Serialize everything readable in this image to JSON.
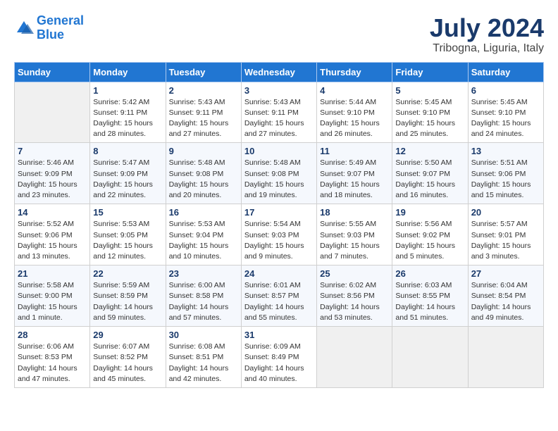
{
  "logo": {
    "line1": "General",
    "line2": "Blue"
  },
  "title": "July 2024",
  "subtitle": "Tribogna, Liguria, Italy",
  "weekdays": [
    "Sunday",
    "Monday",
    "Tuesday",
    "Wednesday",
    "Thursday",
    "Friday",
    "Saturday"
  ],
  "weeks": [
    [
      {
        "day": "",
        "info": ""
      },
      {
        "day": "1",
        "info": "Sunrise: 5:42 AM\nSunset: 9:11 PM\nDaylight: 15 hours\nand 28 minutes."
      },
      {
        "day": "2",
        "info": "Sunrise: 5:43 AM\nSunset: 9:11 PM\nDaylight: 15 hours\nand 27 minutes."
      },
      {
        "day": "3",
        "info": "Sunrise: 5:43 AM\nSunset: 9:11 PM\nDaylight: 15 hours\nand 27 minutes."
      },
      {
        "day": "4",
        "info": "Sunrise: 5:44 AM\nSunset: 9:10 PM\nDaylight: 15 hours\nand 26 minutes."
      },
      {
        "day": "5",
        "info": "Sunrise: 5:45 AM\nSunset: 9:10 PM\nDaylight: 15 hours\nand 25 minutes."
      },
      {
        "day": "6",
        "info": "Sunrise: 5:45 AM\nSunset: 9:10 PM\nDaylight: 15 hours\nand 24 minutes."
      }
    ],
    [
      {
        "day": "7",
        "info": "Sunrise: 5:46 AM\nSunset: 9:09 PM\nDaylight: 15 hours\nand 23 minutes."
      },
      {
        "day": "8",
        "info": "Sunrise: 5:47 AM\nSunset: 9:09 PM\nDaylight: 15 hours\nand 22 minutes."
      },
      {
        "day": "9",
        "info": "Sunrise: 5:48 AM\nSunset: 9:08 PM\nDaylight: 15 hours\nand 20 minutes."
      },
      {
        "day": "10",
        "info": "Sunrise: 5:48 AM\nSunset: 9:08 PM\nDaylight: 15 hours\nand 19 minutes."
      },
      {
        "day": "11",
        "info": "Sunrise: 5:49 AM\nSunset: 9:07 PM\nDaylight: 15 hours\nand 18 minutes."
      },
      {
        "day": "12",
        "info": "Sunrise: 5:50 AM\nSunset: 9:07 PM\nDaylight: 15 hours\nand 16 minutes."
      },
      {
        "day": "13",
        "info": "Sunrise: 5:51 AM\nSunset: 9:06 PM\nDaylight: 15 hours\nand 15 minutes."
      }
    ],
    [
      {
        "day": "14",
        "info": "Sunrise: 5:52 AM\nSunset: 9:06 PM\nDaylight: 15 hours\nand 13 minutes."
      },
      {
        "day": "15",
        "info": "Sunrise: 5:53 AM\nSunset: 9:05 PM\nDaylight: 15 hours\nand 12 minutes."
      },
      {
        "day": "16",
        "info": "Sunrise: 5:53 AM\nSunset: 9:04 PM\nDaylight: 15 hours\nand 10 minutes."
      },
      {
        "day": "17",
        "info": "Sunrise: 5:54 AM\nSunset: 9:03 PM\nDaylight: 15 hours\nand 9 minutes."
      },
      {
        "day": "18",
        "info": "Sunrise: 5:55 AM\nSunset: 9:03 PM\nDaylight: 15 hours\nand 7 minutes."
      },
      {
        "day": "19",
        "info": "Sunrise: 5:56 AM\nSunset: 9:02 PM\nDaylight: 15 hours\nand 5 minutes."
      },
      {
        "day": "20",
        "info": "Sunrise: 5:57 AM\nSunset: 9:01 PM\nDaylight: 15 hours\nand 3 minutes."
      }
    ],
    [
      {
        "day": "21",
        "info": "Sunrise: 5:58 AM\nSunset: 9:00 PM\nDaylight: 15 hours\nand 1 minute."
      },
      {
        "day": "22",
        "info": "Sunrise: 5:59 AM\nSunset: 8:59 PM\nDaylight: 14 hours\nand 59 minutes."
      },
      {
        "day": "23",
        "info": "Sunrise: 6:00 AM\nSunset: 8:58 PM\nDaylight: 14 hours\nand 57 minutes."
      },
      {
        "day": "24",
        "info": "Sunrise: 6:01 AM\nSunset: 8:57 PM\nDaylight: 14 hours\nand 55 minutes."
      },
      {
        "day": "25",
        "info": "Sunrise: 6:02 AM\nSunset: 8:56 PM\nDaylight: 14 hours\nand 53 minutes."
      },
      {
        "day": "26",
        "info": "Sunrise: 6:03 AM\nSunset: 8:55 PM\nDaylight: 14 hours\nand 51 minutes."
      },
      {
        "day": "27",
        "info": "Sunrise: 6:04 AM\nSunset: 8:54 PM\nDaylight: 14 hours\nand 49 minutes."
      }
    ],
    [
      {
        "day": "28",
        "info": "Sunrise: 6:06 AM\nSunset: 8:53 PM\nDaylight: 14 hours\nand 47 minutes."
      },
      {
        "day": "29",
        "info": "Sunrise: 6:07 AM\nSunset: 8:52 PM\nDaylight: 14 hours\nand 45 minutes."
      },
      {
        "day": "30",
        "info": "Sunrise: 6:08 AM\nSunset: 8:51 PM\nDaylight: 14 hours\nand 42 minutes."
      },
      {
        "day": "31",
        "info": "Sunrise: 6:09 AM\nSunset: 8:49 PM\nDaylight: 14 hours\nand 40 minutes."
      },
      {
        "day": "",
        "info": ""
      },
      {
        "day": "",
        "info": ""
      },
      {
        "day": "",
        "info": ""
      }
    ]
  ]
}
